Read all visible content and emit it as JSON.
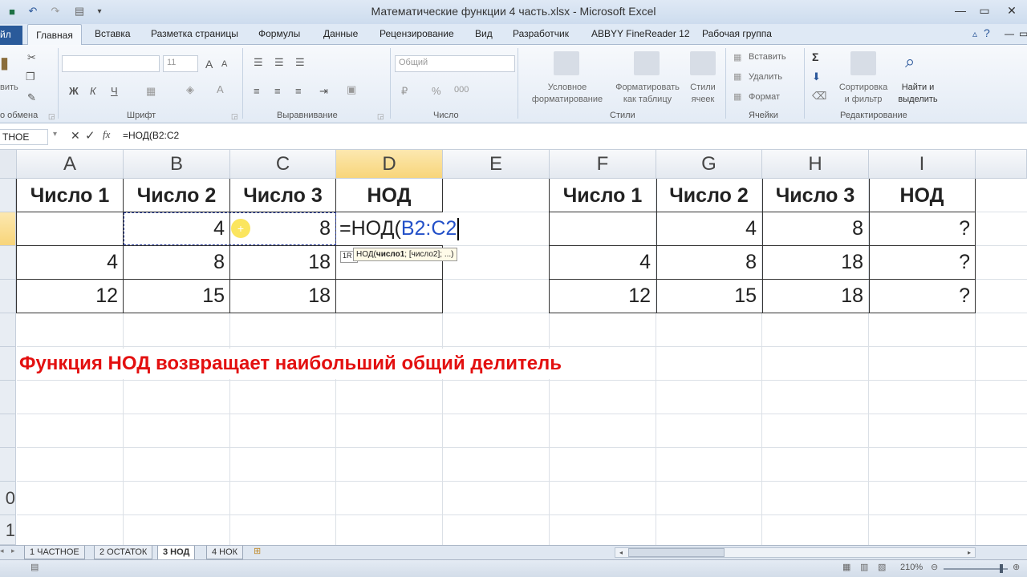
{
  "window": {
    "title": "Математические функции 4 часть.xlsx - Microsoft Excel"
  },
  "ribbon_tabs": [
    "йл",
    "Главная",
    "Вставка",
    "Разметка страницы",
    "Формулы",
    "Данные",
    "Рецензирование",
    "Вид",
    "Разработчик",
    "ABBYY FineReader 12",
    "Рабочая группа"
  ],
  "ribbon": {
    "groups": [
      "о обмена",
      "Шрифт",
      "Выравнивание",
      "Число",
      "Стили",
      "Ячейки",
      "Редактирование"
    ],
    "clipboard_label": "вить",
    "font_name": "",
    "font_size": "11",
    "number_format": "Общий",
    "styles": {
      "conditional": "Условное\nформатирование",
      "as_table": "Форматировать\nкак таблицу",
      "cell_styles": "Стили\nячеек"
    },
    "cells": {
      "insert": "Вставить",
      "delete": "Удалить",
      "format": "Формат"
    },
    "editing": {
      "sort": "Сортировка\nи фильтр",
      "find": "Найти и\nвыделить"
    }
  },
  "formula_bar": {
    "name_box": "ТНОЕ",
    "formula": "=НОД(B2:C2"
  },
  "columns": [
    "A",
    "B",
    "C",
    "D",
    "E",
    "F",
    "G",
    "H",
    "I"
  ],
  "row_numbers": [
    "",
    "",
    "",
    "",
    "",
    "",
    "",
    "",
    "",
    "0",
    "1"
  ],
  "left_table": {
    "headers": [
      "Число 1",
      "Число 2",
      "Число 3",
      "НОД"
    ],
    "rows": [
      [
        "",
        "4",
        "8",
        ""
      ],
      [
        "4",
        "8",
        "18",
        ""
      ],
      [
        "12",
        "15",
        "18",
        ""
      ]
    ]
  },
  "editing_cell": {
    "prefix": "=НОД(",
    "ref": "B2:C2"
  },
  "tooltip": {
    "fn": "НОД(",
    "arg1": "число1",
    "rest": "; [число2]; ...)",
    "badge": "1R"
  },
  "right_table": {
    "headers": [
      "Число 1",
      "Число 2",
      "Число 3",
      "НОД"
    ],
    "rows": [
      [
        "",
        "4",
        "8",
        "?"
      ],
      [
        "4",
        "8",
        "18",
        "?"
      ],
      [
        "12",
        "15",
        "18",
        "?"
      ]
    ]
  },
  "note": "Функция НОД возвращает наибольший общий делитель",
  "sheet_tabs": [
    "1 ЧАСТНОЕ",
    "2 ОСТАТОК",
    "3 НОД",
    "4 НОК"
  ],
  "active_sheet": "3 НОД",
  "zoom": "210%",
  "colors": {
    "accent": "#2b579a",
    "note": "#e31010",
    "ref": "#2350c8"
  }
}
